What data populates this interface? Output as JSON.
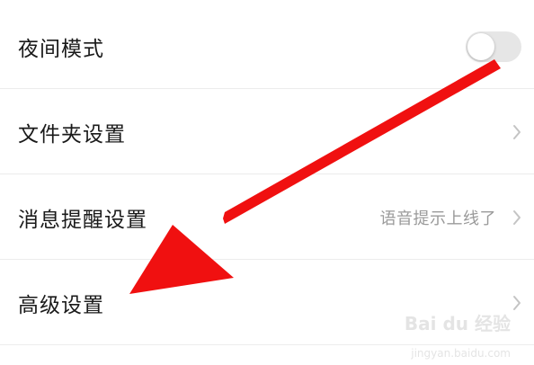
{
  "settings": {
    "items": [
      {
        "label": "夜间模式",
        "value": "",
        "control": "toggle",
        "toggle_on": false
      },
      {
        "label": "文件夹设置",
        "value": "",
        "control": "chevron"
      },
      {
        "label": "消息提醒设置",
        "value": "语音提示上线了",
        "control": "chevron"
      },
      {
        "label": "高级设置",
        "value": "",
        "control": "chevron"
      }
    ]
  },
  "annotation": {
    "arrow_color": "#f01010",
    "icon": "red-arrow-icon"
  },
  "watermark": {
    "brand": "Bai du 经验",
    "url": "jingyan.baidu.com"
  },
  "colors": {
    "text": "#1a1a1a",
    "secondary_text": "#9a9a9a",
    "divider": "#ececec",
    "toggle_off": "#e6e6e6"
  }
}
